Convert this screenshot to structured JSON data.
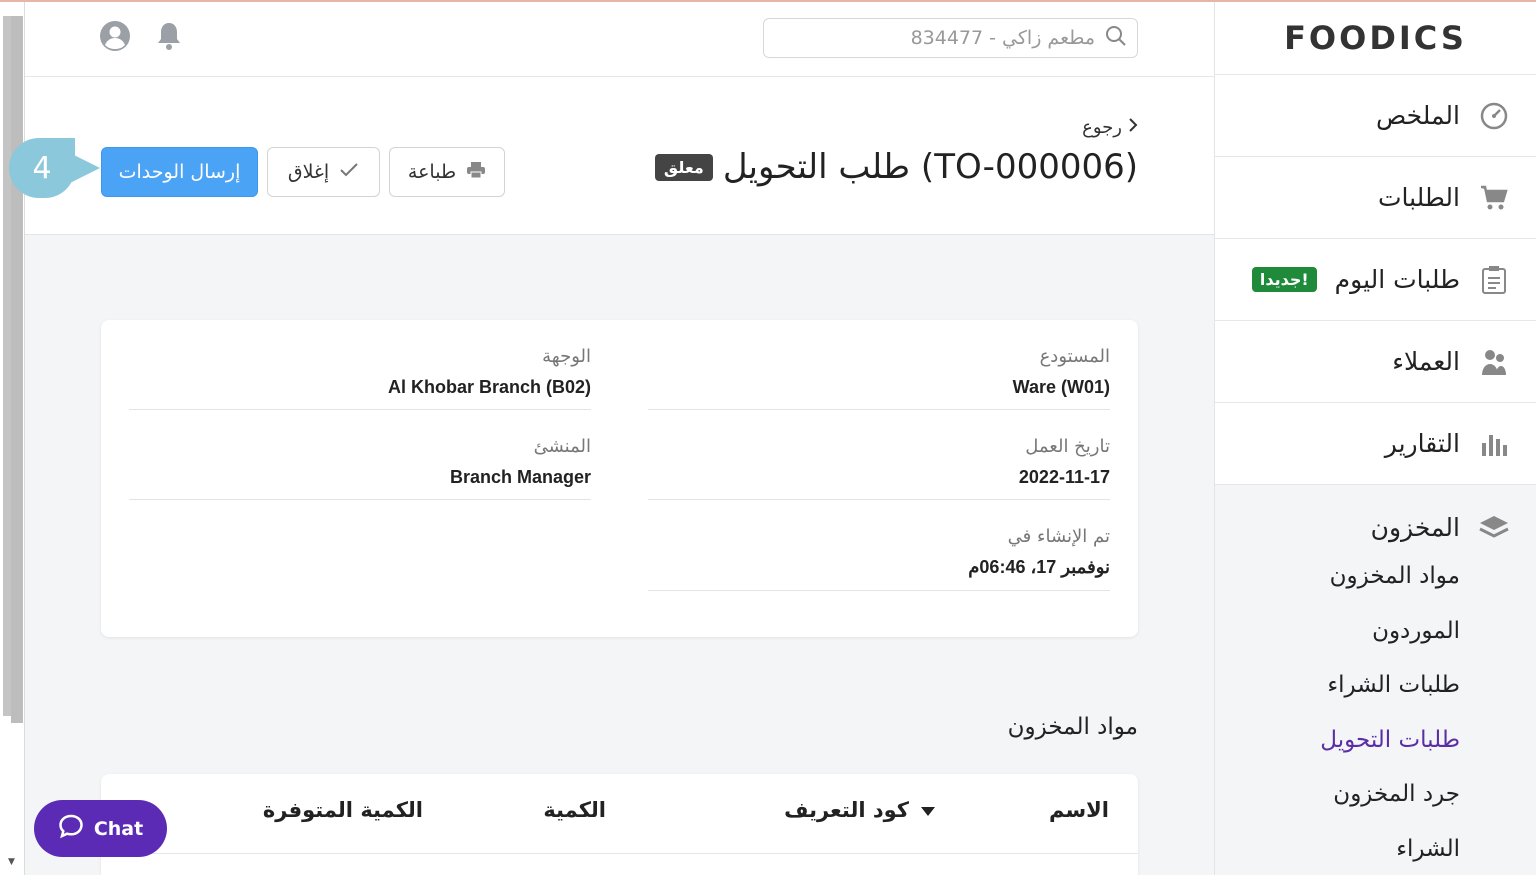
{
  "brand": {
    "logo": "FOODICS"
  },
  "header": {
    "search_placeholder": "مطعم زاكي - 834477",
    "icons": [
      "user-icon",
      "bell-icon"
    ]
  },
  "sidebar": {
    "items": [
      {
        "label": "الملخص",
        "icon": "dashboard-icon"
      },
      {
        "label": "الطلبات",
        "icon": "cart-icon"
      },
      {
        "label": "طلبات اليوم",
        "icon": "clipboard-icon",
        "badge": "جديدا!"
      },
      {
        "label": "العملاء",
        "icon": "users-icon"
      },
      {
        "label": "التقارير",
        "icon": "chart-icon"
      }
    ],
    "inventory": {
      "label": "المخزون",
      "icon": "layers-icon",
      "sub_items": [
        "مواد المخزون",
        "الموردون",
        "طلبات الشراء",
        "طلبات التحويل",
        "جرد المخزون",
        "الشراء"
      ],
      "active": "طلبات التحويل"
    }
  },
  "page": {
    "back_label": "رجوع",
    "title": "طلب التحويل (TO-000006)",
    "status": "معلق",
    "actions": {
      "print": "طباعة",
      "close": "إغلاق",
      "send": "إرسال الوحدات"
    },
    "step_number": "4"
  },
  "details": {
    "warehouse_label": "المستودع",
    "warehouse_value": "Ware (W01)",
    "destination_label": "الوجهة",
    "destination_value": "Al Khobar Branch (B02)",
    "business_date_label": "تاريخ العمل",
    "business_date_value": "2022-11-17",
    "creator_label": "المنشئ",
    "creator_value": "Branch Manager",
    "created_at_label": "تم الإنشاء في",
    "created_at_value": "نوفمبر 17، 06:46م"
  },
  "items_section": {
    "title": "مواد المخزون",
    "columns": [
      "الاسم",
      "كود التعريف",
      "الكمية",
      "الكمية المتوفرة"
    ]
  },
  "chat": {
    "label": "Chat"
  }
}
